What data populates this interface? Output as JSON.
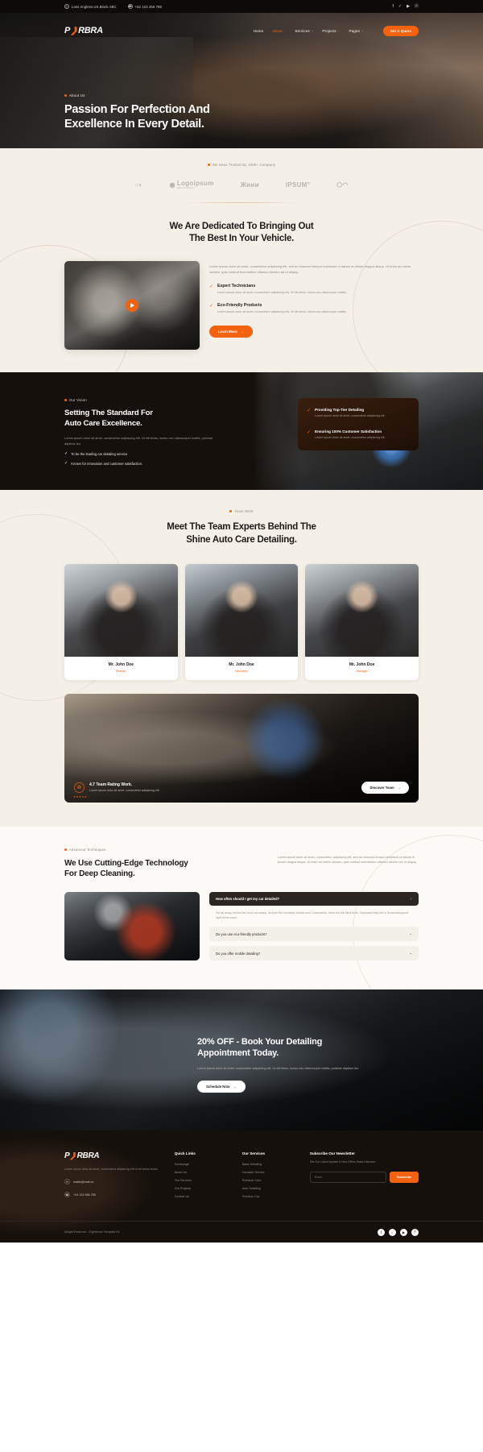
{
  "topbar": {
    "address": "Loss Angless US Block ABC",
    "phone": "+62 123 456 789",
    "location_icon": "map-pin-icon",
    "phone_icon": "phone-icon",
    "social": [
      {
        "name": "facebook-icon",
        "glyph": "f"
      },
      {
        "name": "twitter-icon",
        "glyph": "✓"
      },
      {
        "name": "youtube-icon",
        "glyph": "▶"
      },
      {
        "name": "pinterest-icon",
        "glyph": "ⓟ"
      }
    ]
  },
  "nav": {
    "logo_left": "P",
    "logo_swoosh": "❱",
    "logo_right": "RBRA",
    "items": [
      {
        "label": "Home",
        "active": false,
        "caret": ""
      },
      {
        "label": "About",
        "active": true,
        "caret": "⌄"
      },
      {
        "label": "Services",
        "active": false,
        "caret": "⌄"
      },
      {
        "label": "Projects",
        "active": false,
        "caret": "⌄"
      },
      {
        "label": "Pages",
        "active": false,
        "caret": "⌄"
      }
    ],
    "cta_label": "Get A Quote"
  },
  "hero": {
    "eyebrow": "About Us",
    "title_line1": "Passion For Perfection And",
    "title_line2": "Excellence In Every Detail."
  },
  "brands": {
    "eyebrow": "We Have Trusted By 1000+ Company",
    "logos": [
      {
        "name": "logoipsum-circles",
        "text": "○◐",
        "sub": ""
      },
      {
        "name": "logoipsum-brand",
        "text": "Logoipsum",
        "sub": "Brand Standard"
      },
      {
        "name": "lipsum-wave",
        "text": "Жиии",
        "sub": ""
      },
      {
        "name": "ipsum-mark",
        "text": "IPSUM°",
        "sub": ""
      },
      {
        "name": "logo-faded",
        "text": "⬡◠",
        "sub": ""
      }
    ]
  },
  "dedicated": {
    "title_line1": "We Are Dedicated To Bringing Out",
    "title_line2": "The Best In Your Vehicle.",
    "paragraph": "Lorem ipsum dolor sit amet, consectetur adipiscing elit, sed do eiusmod tempor incididunt ut labore et dolore magna aliqua. Ut enim ad minim veniam, quis nostrud exercitation ullamco laboris nisi ut aliquip.",
    "play_icon": "play-button-icon",
    "features": [
      {
        "title": "Expert Technicians",
        "desc": "Lorem ipsum dolor sit amet, consectetur adipiscing elit. Ut elit tellus, luctus nec ullamcorper mattis."
      },
      {
        "title": "Eco-Friendly Products",
        "desc": "Lorem ipsum dolor sit amet, consectetur adipiscing elit. Ut elit tellus, luctus nec ullamcorper mattis."
      }
    ],
    "button_label": "Learn More",
    "button_arrow": "→"
  },
  "vision": {
    "eyebrow": "Our Vision",
    "title_line1": "Setting The Standard For",
    "title_line2": "Auto Care Excellence.",
    "desc": "Lorem ipsum dolor sit amet, consectetur adipiscing elit. Ut elit tellus, luctus nec ullamcorper mattis, pulvinar dapibus leo.",
    "list": [
      "To be the leading car detailing service",
      "Known for innovation and customer satisfaction."
    ],
    "cards": [
      {
        "title": "Providing Top-Tier Detailing",
        "desc": "Lorem ipsum dolor sit amet, consectetur adipiscing elit."
      },
      {
        "title": "Ensuring 100% Customer Satisfaction",
        "desc": "Lorem ipsum dolor sit amet, consectetur adipiscing elit."
      }
    ]
  },
  "team": {
    "eyebrow": "Team Work",
    "title_line1": "Meet The Team Experts Behind The",
    "title_line2": "Shine Auto Care Detailing.",
    "members": [
      {
        "name": "Mr. John Doe",
        "role": "Director"
      },
      {
        "name": "Mr. John Doe",
        "role": "Mechanic"
      },
      {
        "name": "Mr. John Doe",
        "role": "Manager"
      }
    ],
    "rating": {
      "badge_icon": "rosette-icon",
      "stars": "★★★★★",
      "title": "4.7 Team Rating Work.",
      "desc": "Lorem ipsum dolor sit amet, consectetur adipiscing elit.",
      "button_label": "Discover Team",
      "button_arrow": "→"
    }
  },
  "tech": {
    "eyebrow": "Advanced Techniques",
    "title_line1": "We Use Cutting-Edge Technology",
    "title_line2": "For Deep Cleaning.",
    "paragraph": "Lorem ipsum dolor sit amet, consectetur adipiscing elit, sed do eiusmod tempor incididunt ut labore et dolore magna aliqua. Ut enim ad minim veniam, quis nostrud exercitation ullamco laboris nisi ut aliquip.",
    "faq": [
      {
        "question": "How often should I get my car detailed?",
        "open": true,
        "icon": "↑",
        "answer": "Far far away, behind the word mountains, far from the countries Vokalia and Consonantia, there live the blind texts. Separated they live in Bookmarksgrove right at the coast."
      },
      {
        "question": "Do you use eco-friendly products?",
        "open": false,
        "icon": "⌄",
        "answer": ""
      },
      {
        "question": "Do you offer mobile detailing?",
        "open": false,
        "icon": "⌄",
        "answer": ""
      }
    ]
  },
  "cta": {
    "title_line1": "20% OFF - Book Your Detailing",
    "title_line2": "Appointment Today.",
    "desc": "Lorem ipsum dolor sit amet, consectetur adipiscing elit. Ut elit tellus, luctus nec ullamcorper mattis, pulvinar dapibus leo.",
    "button_label": "Schedule Now",
    "button_arrow": "→"
  },
  "footer": {
    "logo_left": "P",
    "logo_swoosh": "❱",
    "logo_right": "RBRA",
    "desc": "Lorem ipsum dolor sit amet, consectetur adipiscing elit ut elit tellus luctus.",
    "email": "mailto@mail.co",
    "email_icon": "envelope-icon",
    "phone": "+44 123 456 789",
    "phone_icon": "phone-icon",
    "quick_links": {
      "title": "Quick Links",
      "items": [
        "Homepage",
        "About Us",
        "Our Services",
        "Our Projects",
        "Contact Us"
      ]
    },
    "services": {
      "title": "Our Services",
      "items": [
        "Basic Detailing",
        "Carwash Service",
        "Premium Care",
        "Auto Detailing",
        "Premium Car"
      ]
    },
    "newsletter": {
      "title": "Subscribe Our Newsletter",
      "desc": "Get Our Latest Update & New Offers Sales Discount",
      "placeholder": "Email",
      "value": "",
      "button_label": "Subscribe"
    },
    "copyright": "Allright Reserved - Eighthome Template Kit",
    "social": [
      {
        "name": "facebook-icon",
        "glyph": "f"
      },
      {
        "name": "twitter-icon",
        "glyph": "✓"
      },
      {
        "name": "youtube-icon",
        "glyph": "▶"
      },
      {
        "name": "pinterest-icon",
        "glyph": "ⓟ"
      }
    ]
  }
}
